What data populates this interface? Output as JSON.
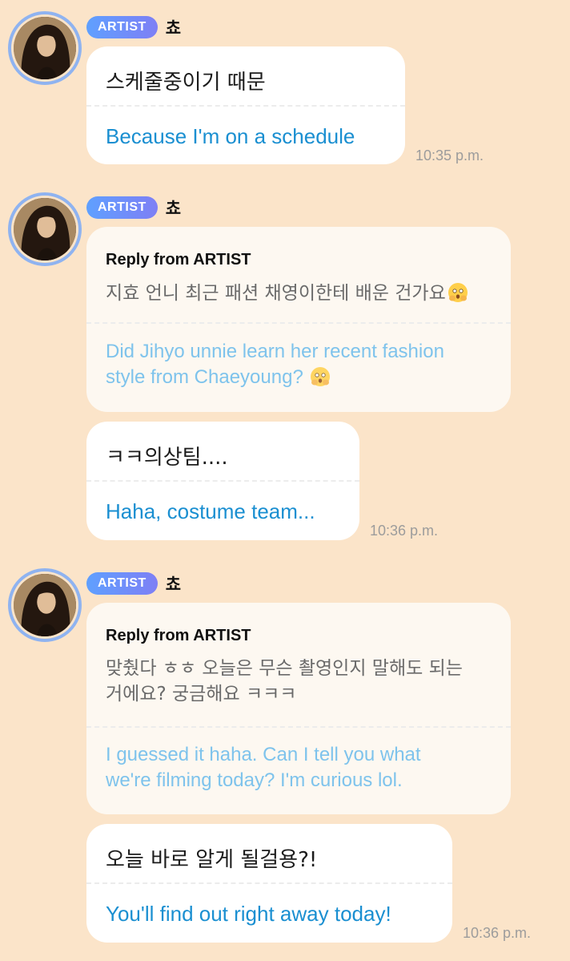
{
  "colors": {
    "background": "#fbe4c9",
    "badge": "#6b95f7",
    "translation_blue": "#1a8fd1",
    "reply_translation_blue": "#7ec3ec",
    "timestamp_gray": "#9c9c9c"
  },
  "messages": [
    {
      "badge": "ARTIST",
      "name": "쵸",
      "korean": "스케줄중이기 때문",
      "english": "Because I'm on a schedule",
      "time": "10:35 p.m."
    },
    {
      "badge": "ARTIST",
      "name": "쵸",
      "reply_title": "Reply from ARTIST",
      "reply_korean": "지효 언니 최근 패션 채영이한테 배운 건가요",
      "reply_english_line1": "Did Jihyo unnie learn her recent fashion",
      "reply_english_line2": "style from Chaeyoung?",
      "reply_emoji": "flushed-face-hands-icon",
      "korean": "ㅋㅋ의상팀....",
      "english": "Haha, costume team...",
      "time": "10:36 p.m."
    },
    {
      "badge": "ARTIST",
      "name": "쵸",
      "reply_title": "Reply from ARTIST",
      "reply_korean_line1": "맞췄다 ㅎㅎ 오늘은 무슨 촬영인지 말해도 되는",
      "reply_korean_line2": "거에요? 궁금해요 ㅋㅋㅋ",
      "reply_english_line1": "I guessed it haha. Can I tell you what",
      "reply_english_line2": "we're filming today? I'm curious lol.",
      "korean": "오늘 바로 알게 될걸용?!",
      "english": "You'll find out right away today!",
      "time": "10:36 p.m."
    }
  ]
}
